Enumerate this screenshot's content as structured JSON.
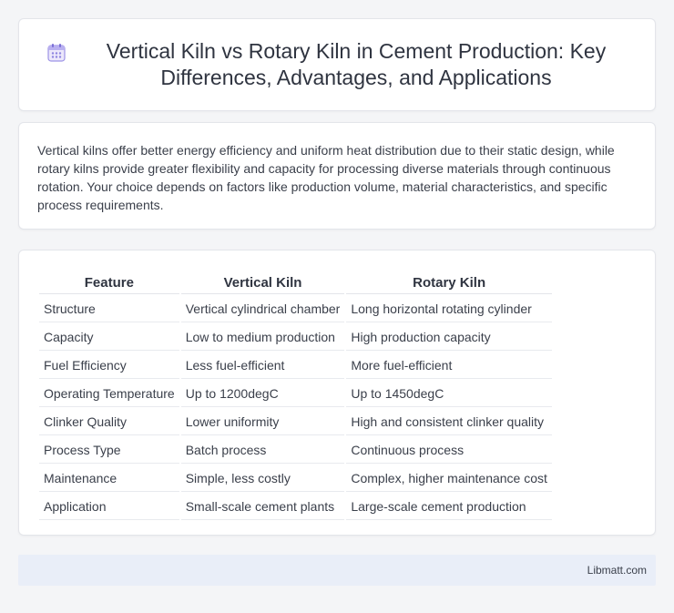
{
  "header": {
    "icon": "calendar-grid-icon",
    "title": "Vertical Kiln vs Rotary Kiln in Cement Production: Key Differences, Advantages, and Applications"
  },
  "intro": {
    "text": "Vertical kilns offer better energy efficiency and uniform heat distribution due to their static design, while rotary kilns provide greater flexibility and capacity for processing diverse materials through continuous rotation. Your choice depends on factors like production volume, material characteristics, and specific process requirements."
  },
  "table": {
    "headers": [
      "Feature",
      "Vertical Kiln",
      "Rotary Kiln"
    ],
    "rows": [
      [
        "Structure",
        "Vertical cylindrical chamber",
        "Long horizontal rotating cylinder"
      ],
      [
        "Capacity",
        "Low to medium production",
        "High production capacity"
      ],
      [
        "Fuel Efficiency",
        "Less fuel-efficient",
        "More fuel-efficient"
      ],
      [
        "Operating Temperature",
        "Up to 1200degC",
        "Up to 1450degC"
      ],
      [
        "Clinker Quality",
        "Lower uniformity",
        "High and consistent clinker quality"
      ],
      [
        "Process Type",
        "Batch process",
        "Continuous process"
      ],
      [
        "Maintenance",
        "Simple, less costly",
        "Complex, higher maintenance cost"
      ],
      [
        "Application",
        "Small-scale cement plants",
        "Large-scale cement production"
      ]
    ]
  },
  "footer": {
    "brand": "Libmatt.com"
  },
  "colors": {
    "background": "#f4f5f7",
    "card": "#ffffff",
    "footer": "#e9eef8",
    "icon_accent": "#7b6fd6"
  }
}
